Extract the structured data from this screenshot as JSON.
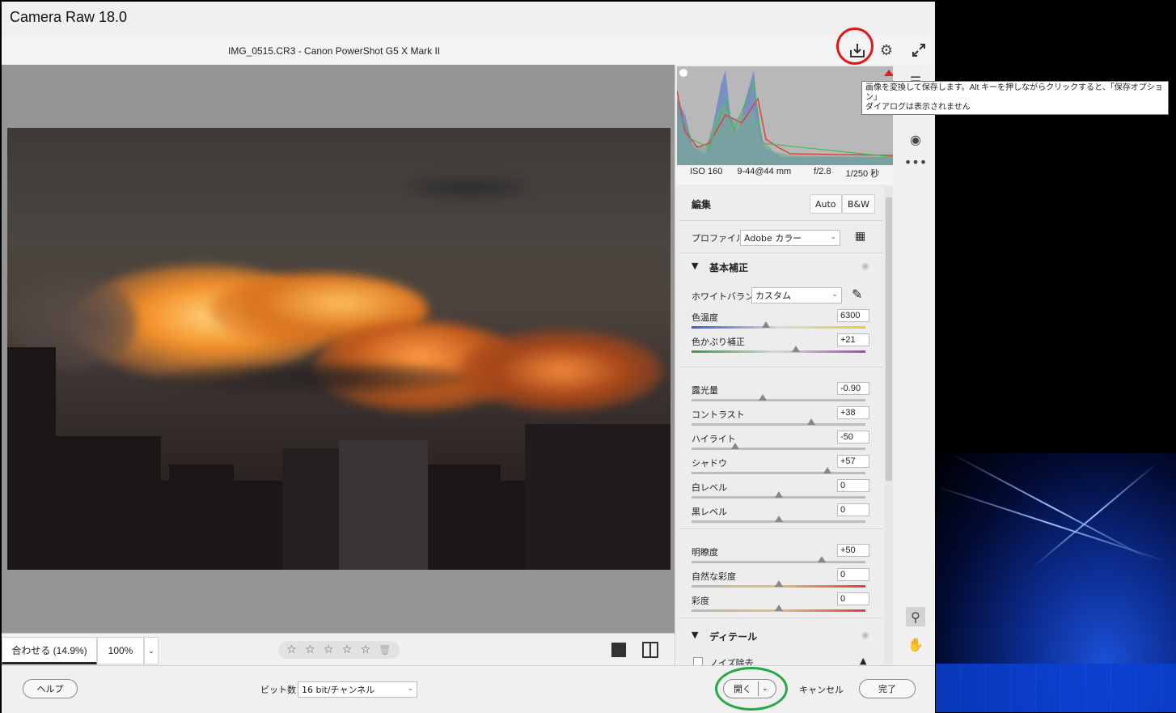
{
  "window": {
    "title": "Camera Raw 18.0",
    "file_label": "IMG_0515.CR3  -  Canon PowerShot G5 X Mark II"
  },
  "toolbar": {
    "save_icon": "save-icon",
    "settings_icon": "gear-icon",
    "fullscreen_icon": "expand-icon"
  },
  "tooltip": {
    "line1": "画像を変換して保存します。Alt キーを押しながらクリックすると、「保存オプション」",
    "line2": "ダイアログは表示されません"
  },
  "exif": {
    "iso": "ISO 160",
    "focal": "9-44@44 mm",
    "aperture": "f/2.8",
    "shutter": "1/250 秒"
  },
  "edit": {
    "heading": "編集",
    "auto": "Auto",
    "bw": "B&W",
    "profile_label": "プロファイル",
    "profile_value": "Adobe カラー"
  },
  "basic": {
    "heading": "基本補正",
    "wb_label": "ホワイトバランス",
    "wb_value": "カスタム",
    "sliders": [
      {
        "label": "色温度",
        "value": "6300",
        "pos": 0.43
      },
      {
        "label": "色かぶり補正",
        "value": "+21",
        "pos": 0.6
      },
      {
        "label": "露光量",
        "value": "-0.90",
        "pos": 0.41
      },
      {
        "label": "コントラスト",
        "value": "+38",
        "pos": 0.69
      },
      {
        "label": "ハイライト",
        "value": "-50",
        "pos": 0.25
      },
      {
        "label": "シャドウ",
        "value": "+57",
        "pos": 0.78
      },
      {
        "label": "白レベル",
        "value": "0",
        "pos": 0.5
      },
      {
        "label": "黒レベル",
        "value": "0",
        "pos": 0.5
      },
      {
        "label": "明瞭度",
        "value": "+50",
        "pos": 0.75
      },
      {
        "label": "自然な彩度",
        "value": "0",
        "pos": 0.5
      },
      {
        "label": "彩度",
        "value": "0",
        "pos": 0.5
      }
    ]
  },
  "detail": {
    "heading": "ディテール",
    "noise_label": "ノイズ除去"
  },
  "preview_footer": {
    "fit": "合わせる (14.9%)",
    "zoom": "100%"
  },
  "bottom": {
    "help": "ヘルプ",
    "bitdepth_label": "ビット数：",
    "bitdepth_value": "16 bit/チャンネル",
    "open": "開く",
    "cancel": "キャンセル",
    "done": "完了"
  },
  "colors": {
    "red_highlight": "#e01818",
    "green_highlight": "#27a844"
  }
}
